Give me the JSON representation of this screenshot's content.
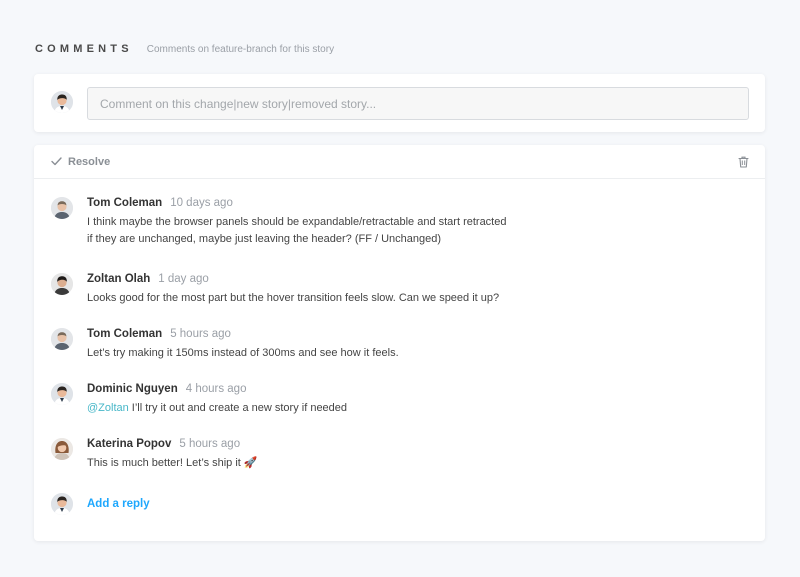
{
  "header": {
    "title": "COMMENTS",
    "subtitle": "Comments on feature-branch for this story"
  },
  "compose": {
    "placeholder": "Comment on this change|new story|removed story..."
  },
  "thread": {
    "resolve_label": "Resolve",
    "comments": [
      {
        "author": "Tom Coleman",
        "time": "10 days ago",
        "text": "I think maybe the browser panels should be expandable/retractable and start retracted if they are unchanged, maybe just leaving the header? (FF / Unchanged)"
      },
      {
        "author": "Zoltan Olah",
        "time": "1 day ago",
        "text": "Looks good for the most part but the hover transition feels slow. Can we speed it up?"
      },
      {
        "author": "Tom Coleman",
        "time": "5 hours ago",
        "text": "Let’s try making it 150ms instead of 300ms and see how it feels."
      },
      {
        "author": "Dominic Nguyen",
        "time": "4 hours ago",
        "mention": "@Zoltan",
        "text": " I’ll try it out and create a new story if needed"
      },
      {
        "author": "Katerina Popov",
        "time": "5 hours ago",
        "text": "This is much better! Let’s ship it 🚀"
      }
    ],
    "reply_label": "Add a reply"
  },
  "colors": {
    "accent": "#1ea7fd",
    "mention": "#47b7c8",
    "background": "#f6f8fb"
  }
}
